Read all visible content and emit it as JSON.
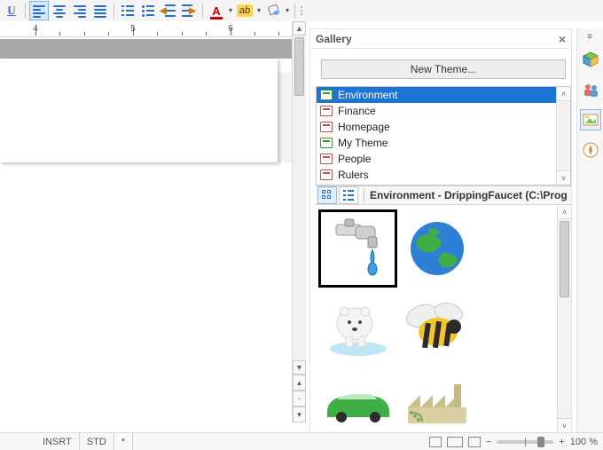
{
  "toolbar": {
    "underline": "U"
  },
  "ruler": {
    "marks": [
      "4",
      "5",
      "6"
    ]
  },
  "gallery": {
    "title": "Gallery",
    "new_theme": "New Theme...",
    "themes": [
      "Environment",
      "Finance",
      "Homepage",
      "My Theme",
      "People",
      "Rulers"
    ],
    "selected_theme_index": 0,
    "path_label": "Environment - DrippingFaucet (C:\\Prog",
    "items": [
      {
        "name": "DrippingFaucet"
      },
      {
        "name": "Earth"
      },
      {
        "name": "PolarBear"
      },
      {
        "name": "Bee"
      },
      {
        "name": "GreenCar"
      },
      {
        "name": "Factory"
      }
    ],
    "selected_item_index": 0
  },
  "status": {
    "insrt": "INSRT",
    "std": "STD",
    "star": "*",
    "zoom_pct": "100 %"
  }
}
